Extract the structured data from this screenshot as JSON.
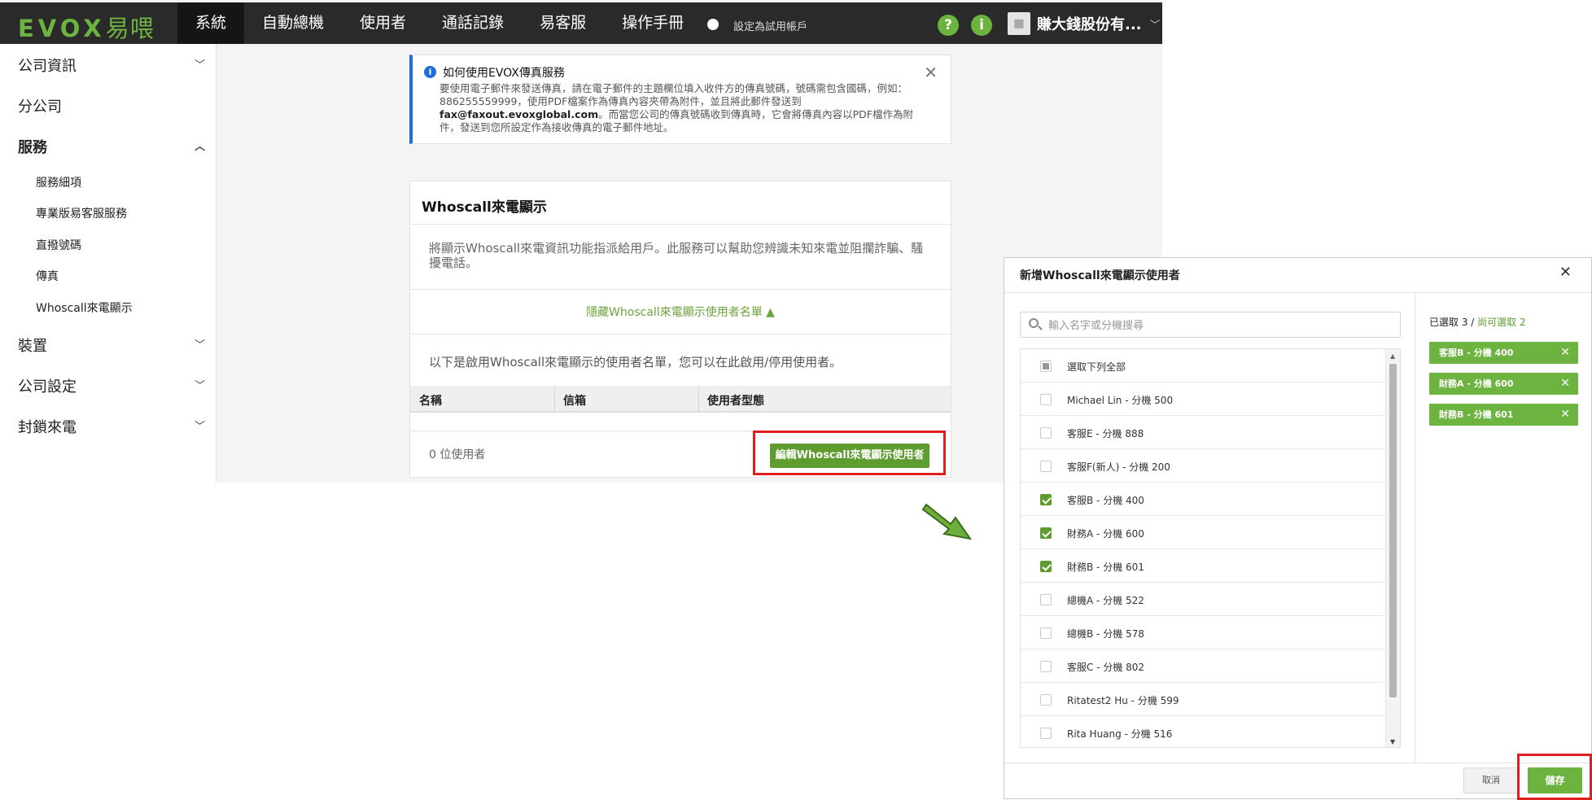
{
  "app": {
    "logo_text": "EVOX",
    "logo_cn": "易喂",
    "nav": [
      "系統",
      "自動總機",
      "使用者",
      "通話記錄",
      "易客服",
      "操作手冊"
    ],
    "trial_label": "設定為試用帳戶",
    "help_icon_char": "?",
    "info_icon_char": "i",
    "company_name": "賺大錢股份有...",
    "accent_color": "#6db33f"
  },
  "sidebar": {
    "company_info": "公司資訊",
    "branch": "分公司",
    "services": "服務",
    "service_items": [
      "服務細項",
      "專業版易客服服務",
      "直撥號碼",
      "傳真",
      "Whoscall來電顯示"
    ],
    "devices": "裝置",
    "company_settings": "公司設定",
    "block_calls": "封鎖來電"
  },
  "alert": {
    "title": "如何使用EVOX傳真服務",
    "body_1": "要使用電子郵件來發送傳真，請在電子郵件的主題欄位填入收件方的傳真號碼，號碼需包含國碼，例如：886255559999，使用PDF檔案作為傳真內容夾帶為附件，並且將此郵件發送到",
    "email": "fax@faxout.evoxglobal.com",
    "body_2": "。而當您公司的傳真號碼收到傳真時，它會將傳真內容以PDF檔作為附件，發送到您所設定作為接收傳真的電子郵件地址。"
  },
  "whoscall": {
    "title": "Whoscall來電顯示",
    "description": "將顯示Whoscall來電資訊功能指派給用戶。此服務可以幫助您辨識未知來電並阻攔詐騙、騷擾電話。",
    "toggle_label": "隱藏Whoscall來電顯示使用者名單",
    "list_description": "以下是啟用Whoscall來電顯示的使用者名單，您可以在此啟用/停用使用者。",
    "columns": [
      "名稱",
      "信箱",
      "使用者型態"
    ],
    "user_count": "0 位使用者",
    "edit_button": "編輯Whoscall來電顯示使用者"
  },
  "modal": {
    "title": "新增Whoscall來電顯示使用者",
    "search_placeholder": "輸入名字或分機搜尋",
    "select_all_label": "選取下列全部",
    "users": [
      {
        "label": "Michael Lin - 分機 500",
        "checked": false
      },
      {
        "label": "客服E - 分機 888",
        "checked": false
      },
      {
        "label": "客服F(新人) - 分機 200",
        "checked": false
      },
      {
        "label": "客服B - 分機 400",
        "checked": true
      },
      {
        "label": "財務A - 分機 600",
        "checked": true
      },
      {
        "label": "財務B - 分機 601",
        "checked": true
      },
      {
        "label": "總機A - 分機 522",
        "checked": false
      },
      {
        "label": "總機B - 分機 578",
        "checked": false
      },
      {
        "label": "客服C - 分機 802",
        "checked": false
      },
      {
        "label": "Ritatest2 Hu - 分機 599",
        "checked": false
      },
      {
        "label": "Rita Huang - 分機 516",
        "checked": false
      }
    ],
    "selected_summary": "已選取 3",
    "remaining_summary": "尚可選取 2",
    "selected_chips": [
      "客服B - 分機 400",
      "財務A - 分機 600",
      "財務B - 分機 601"
    ],
    "cancel_label": "取消",
    "save_label": "儲存"
  }
}
